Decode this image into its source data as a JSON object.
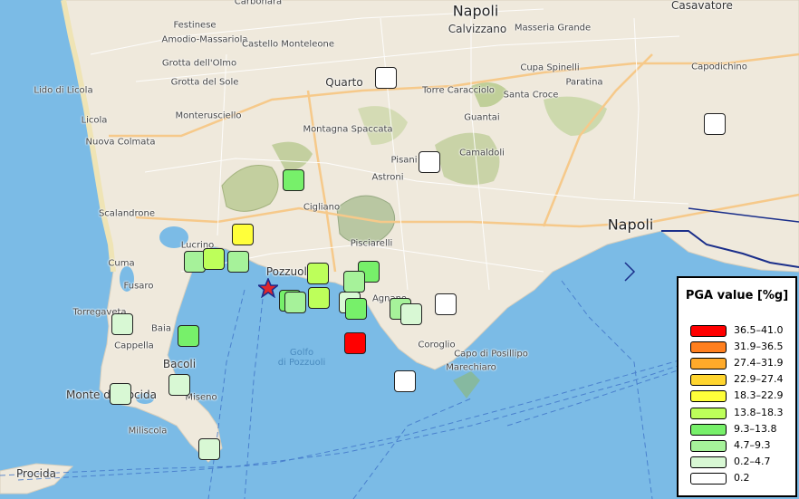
{
  "map": {
    "places": [
      {
        "name": "Napoli",
        "size": "big"
      },
      {
        "name": "Calvizzano",
        "size": "mid"
      },
      {
        "name": "Casavatore",
        "size": "mid"
      },
      {
        "name": "Carbonara",
        "size": "small"
      },
      {
        "name": "Festinese",
        "size": "small"
      },
      {
        "name": "Amodio-Massariola",
        "size": "small"
      },
      {
        "name": "Castello Monteleone",
        "size": "small"
      },
      {
        "name": "Masseria Grande",
        "size": "small"
      },
      {
        "name": "Grotta dell'Olmo",
        "size": "small"
      },
      {
        "name": "Cupa Spinelli",
        "size": "small"
      },
      {
        "name": "Capodichino",
        "size": "small"
      },
      {
        "name": "Grotta del Sole",
        "size": "small"
      },
      {
        "name": "Quarto",
        "size": "mid"
      },
      {
        "name": "Torre Caracciolo",
        "size": "small"
      },
      {
        "name": "Paratina",
        "size": "small"
      },
      {
        "name": "Lido di Licola",
        "size": "small"
      },
      {
        "name": "Santa Croce",
        "size": "small"
      },
      {
        "name": "Monterusciello",
        "size": "small"
      },
      {
        "name": "Guantai",
        "size": "small"
      },
      {
        "name": "Licola",
        "size": "small"
      },
      {
        "name": "Montagna Spaccata",
        "size": "small"
      },
      {
        "name": "Nuova Colmata",
        "size": "small"
      },
      {
        "name": "Camaldoli",
        "size": "small"
      },
      {
        "name": "Pisani",
        "size": "small"
      },
      {
        "name": "Astroni",
        "size": "small"
      },
      {
        "name": "Scalandrone",
        "size": "small"
      },
      {
        "name": "Cigliano",
        "size": "small"
      },
      {
        "name": "Napoli",
        "size": "big"
      },
      {
        "name": "Pisciarelli",
        "size": "small"
      },
      {
        "name": "Lucrino",
        "size": "small"
      },
      {
        "name": "Cuma",
        "size": "small"
      },
      {
        "name": "Pozzuoli",
        "size": "mid"
      },
      {
        "name": "Fusaro",
        "size": "small"
      },
      {
        "name": "Agnano",
        "size": "small"
      },
      {
        "name": "Torregaveta",
        "size": "small"
      },
      {
        "name": "Baia",
        "size": "small"
      },
      {
        "name": "Coroglio",
        "size": "small"
      },
      {
        "name": "Cappella",
        "size": "small"
      },
      {
        "name": "Capo di Posillipo",
        "size": "small"
      },
      {
        "name": "Bacoli",
        "size": "mid"
      },
      {
        "name": "Marechiaro",
        "size": "small"
      },
      {
        "name": "Monte di Procida",
        "size": "mid"
      },
      {
        "name": "Miseno",
        "size": "small"
      },
      {
        "name": "Miliscola",
        "size": "small"
      },
      {
        "name": "Procida",
        "size": "mid"
      }
    ],
    "water_labels": [
      {
        "name": "Golfo\ndi Pozzuoli"
      }
    ],
    "stations": [
      {
        "pga_class": "0.2"
      },
      {
        "pga_class": "0.2"
      },
      {
        "pga_class": "0.2"
      },
      {
        "pga_class": "9.3–13.8"
      },
      {
        "pga_class": "18.3–22.9"
      },
      {
        "pga_class": "4.7–9.3"
      },
      {
        "pga_class": "13.8–18.3"
      },
      {
        "pga_class": "4.7–9.3"
      },
      {
        "pga_class": "13.8–18.3"
      },
      {
        "pga_class": "9.3–13.8"
      },
      {
        "pga_class": "4.7–9.3"
      },
      {
        "pga_class": "9.3–13.8"
      },
      {
        "pga_class": "13.8–18.3"
      },
      {
        "pga_class": "4.7–9.3"
      },
      {
        "pga_class": "0.2–4.7"
      },
      {
        "pga_class": "9.3–13.8"
      },
      {
        "pga_class": "4.7–9.3"
      },
      {
        "pga_class": "0.2–4.7"
      },
      {
        "pga_class": "0.2"
      },
      {
        "pga_class": "36.5–41.0"
      },
      {
        "pga_class": "0.2–4.7"
      },
      {
        "pga_class": "9.3–13.8"
      },
      {
        "pga_class": "0.2–4.7"
      },
      {
        "pga_class": "0.2–4.7"
      },
      {
        "pga_class": "0.2"
      },
      {
        "pga_class": "0.2–4.7"
      }
    ],
    "epicenter_color": "#e0262b"
  },
  "legend": {
    "title": "PGA value [%g]",
    "items": [
      {
        "label": "36.5–41.0",
        "color": "#ff0000"
      },
      {
        "label": "31.9–36.5",
        "color": "#ff7f1e"
      },
      {
        "label": "27.4–31.9",
        "color": "#ffaa2a"
      },
      {
        "label": "22.9–27.4",
        "color": "#ffd52f"
      },
      {
        "label": "18.3–22.9",
        "color": "#ffff3a"
      },
      {
        "label": "13.8–18.3",
        "color": "#bdff5a"
      },
      {
        "label": "9.3–13.8",
        "color": "#77f06a"
      },
      {
        "label": "4.7–9.3",
        "color": "#a6f29a"
      },
      {
        "label": "0.2–4.7",
        "color": "#d8f8d4"
      },
      {
        "label": "0.2",
        "color": "#ffffff"
      }
    ]
  }
}
